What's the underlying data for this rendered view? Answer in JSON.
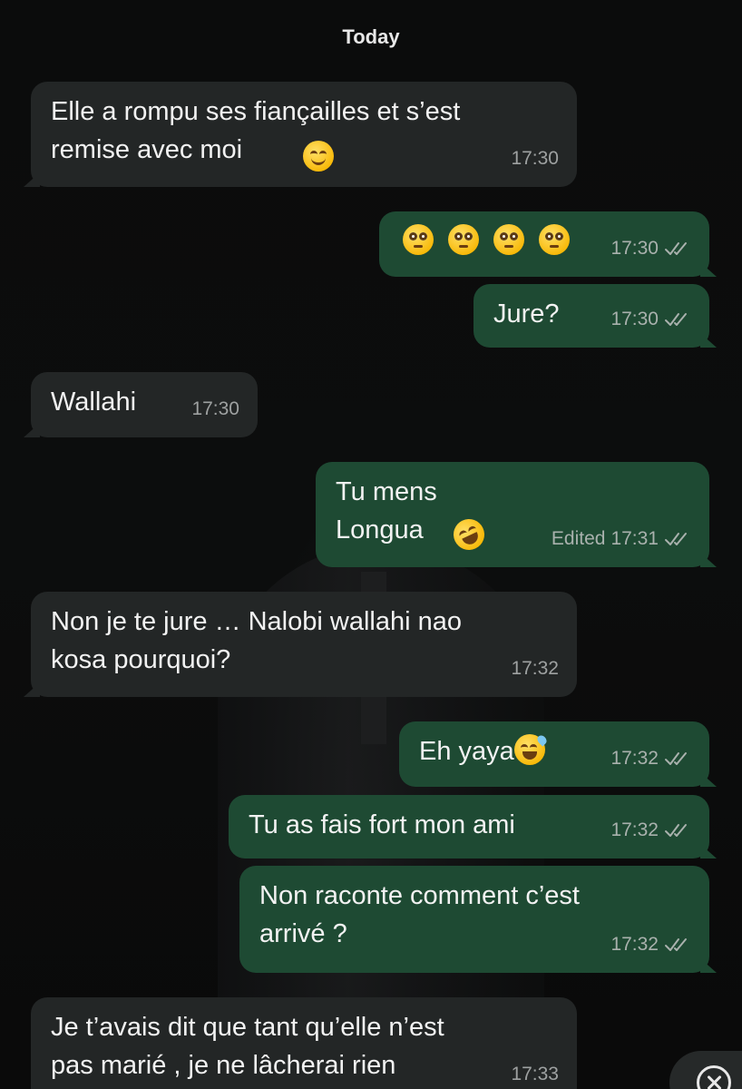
{
  "chat": {
    "day_label": "Today",
    "messages": [
      {
        "direction": "incoming",
        "text": "Elle a rompu ses fiançailles et s’est\nremise avec moi",
        "emoji": "smiling-face-emoji",
        "time": "17:30"
      },
      {
        "direction": "outgoing",
        "text": "",
        "emoji": "flushed-face-emoji x4",
        "time": "17:30",
        "status": "read"
      },
      {
        "direction": "outgoing",
        "text": "Jure?",
        "time": "17:30",
        "status": "read"
      },
      {
        "direction": "incoming",
        "text": "Wallahi",
        "time": "17:30"
      },
      {
        "direction": "outgoing",
        "text": "Tu mens\nLongua",
        "emoji": "rolling-on-floor-laughing-emoji",
        "edited_label": "Edited",
        "time": "17:31",
        "status": "read"
      },
      {
        "direction": "incoming",
        "text": "Non je te jure … Nalobi wallahi nao\nkosa pourquoi?",
        "time": "17:32"
      },
      {
        "direction": "outgoing",
        "text": "Eh yaya",
        "emoji": "grinning-sweat-emoji",
        "time": "17:32",
        "status": "read"
      },
      {
        "direction": "outgoing",
        "text": "Tu as fais fort mon ami",
        "time": "17:32",
        "status": "read"
      },
      {
        "direction": "outgoing",
        "text": "Non raconte comment c’est\narrivé ?",
        "time": "17:32",
        "status": "read"
      },
      {
        "direction": "incoming",
        "text": "Je t’avais dit que tant qu’elle n’est\npas marié , je ne lâcherai rien",
        "time": "17:33"
      }
    ]
  },
  "colors": {
    "background": "#0a0b0b",
    "incoming_bubble": "#232626",
    "outgoing_bubble": "#1e4a33",
    "meta_text": "#a9b1ad"
  },
  "icons": {
    "read_ticks": "double-check-icon",
    "scroll_button": "close-circle-icon"
  }
}
